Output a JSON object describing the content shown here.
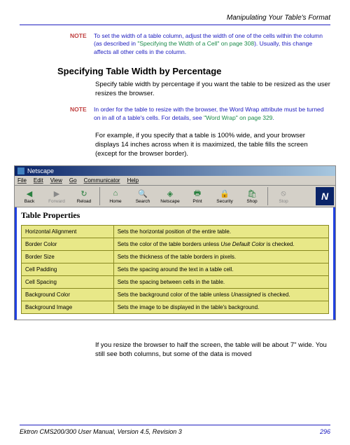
{
  "header": {
    "chapter_title": "Manipulating Your Table's Format"
  },
  "note1": {
    "label": "NOTE",
    "text_a": "To set the width of a table column, adjust the width of one of the cells within the column (as described in ",
    "link": "\"Specifying the Width of a Cell\" on page 308",
    "text_b": "). Usually, this change affects all other cells in the column."
  },
  "section": {
    "heading": "Specifying Table Width by Percentage"
  },
  "para1": "Specify table width by percentage if you want the table to be resized as the user resizes the browser.",
  "note2": {
    "label": "NOTE",
    "text_a": "In order for the table to resize with the browser, the Word Wrap attribute must be turned on in all of a table's cells. For details, see ",
    "link": "\"Word Wrap\" on page 329",
    "text_b": "."
  },
  "para2": "For example, if you specify that a table is 100% wide, and your browser displays 14 inches across when it is maximized, the table fills the screen (except for the browser border).",
  "browser": {
    "title": "Netscape",
    "menu": [
      "File",
      "Edit",
      "View",
      "Go",
      "Communicator",
      "Help"
    ],
    "toolbar": [
      {
        "icon": "back-icon",
        "label": "Back",
        "glyph": "◀",
        "color": "#2a8040"
      },
      {
        "icon": "forward-icon",
        "label": "Forward",
        "glyph": "▶",
        "color": "#888",
        "disabled": true
      },
      {
        "icon": "reload-icon",
        "label": "Reload",
        "glyph": "↻",
        "color": "#2a8040"
      },
      {
        "icon": "home-icon",
        "label": "Home",
        "glyph": "⌂",
        "color": "#2a8040"
      },
      {
        "icon": "search-icon",
        "label": "Search",
        "glyph": "🔍",
        "color": "#2a8040"
      },
      {
        "icon": "netscape-icon",
        "label": "Netscape",
        "glyph": "◈",
        "color": "#2a8040"
      },
      {
        "icon": "print-icon",
        "label": "Print",
        "glyph": "🖶",
        "color": "#2a8040"
      },
      {
        "icon": "security-icon",
        "label": "Security",
        "glyph": "🔒",
        "color": "#2a8040"
      },
      {
        "icon": "shop-icon",
        "label": "Shop",
        "glyph": "🛍",
        "color": "#2a8040"
      },
      {
        "icon": "stop-icon",
        "label": "Stop",
        "glyph": "⦸",
        "color": "#888",
        "disabled": true
      }
    ],
    "logo": "N",
    "content_heading": "Table Properties",
    "rows": [
      {
        "name": "Horizontal Alignment",
        "desc_a": "Sets the horizontal position of the entire table.",
        "ital": "",
        "desc_b": ""
      },
      {
        "name": "Border Color",
        "desc_a": "Sets the color of the table borders unless ",
        "ital": "Use Default Color",
        "desc_b": " is checked."
      },
      {
        "name": "Border Size",
        "desc_a": "Sets the thickness of the table borders in pixels.",
        "ital": "",
        "desc_b": ""
      },
      {
        "name": "Cell Padding",
        "desc_a": "Sets the spacing around the text in a table cell.",
        "ital": "",
        "desc_b": ""
      },
      {
        "name": "Cell Spacing",
        "desc_a": "Sets the spacing between cells in the table.",
        "ital": "",
        "desc_b": ""
      },
      {
        "name": "Background Color",
        "desc_a": "Sets the background color of the table unless ",
        "ital": "Unassigned",
        "desc_b": " is checked."
      },
      {
        "name": "Background Image",
        "desc_a": "Sets the image to be displayed in the table's background.",
        "ital": "",
        "desc_b": ""
      }
    ]
  },
  "para3": "If you resize the browser to half the screen, the table will be about 7\" wide. You still see both columns, but some of the data is moved",
  "footer": {
    "left": "Ektron CMS200/300 User Manual, Version 4.5, Revision 3",
    "page": "296"
  }
}
